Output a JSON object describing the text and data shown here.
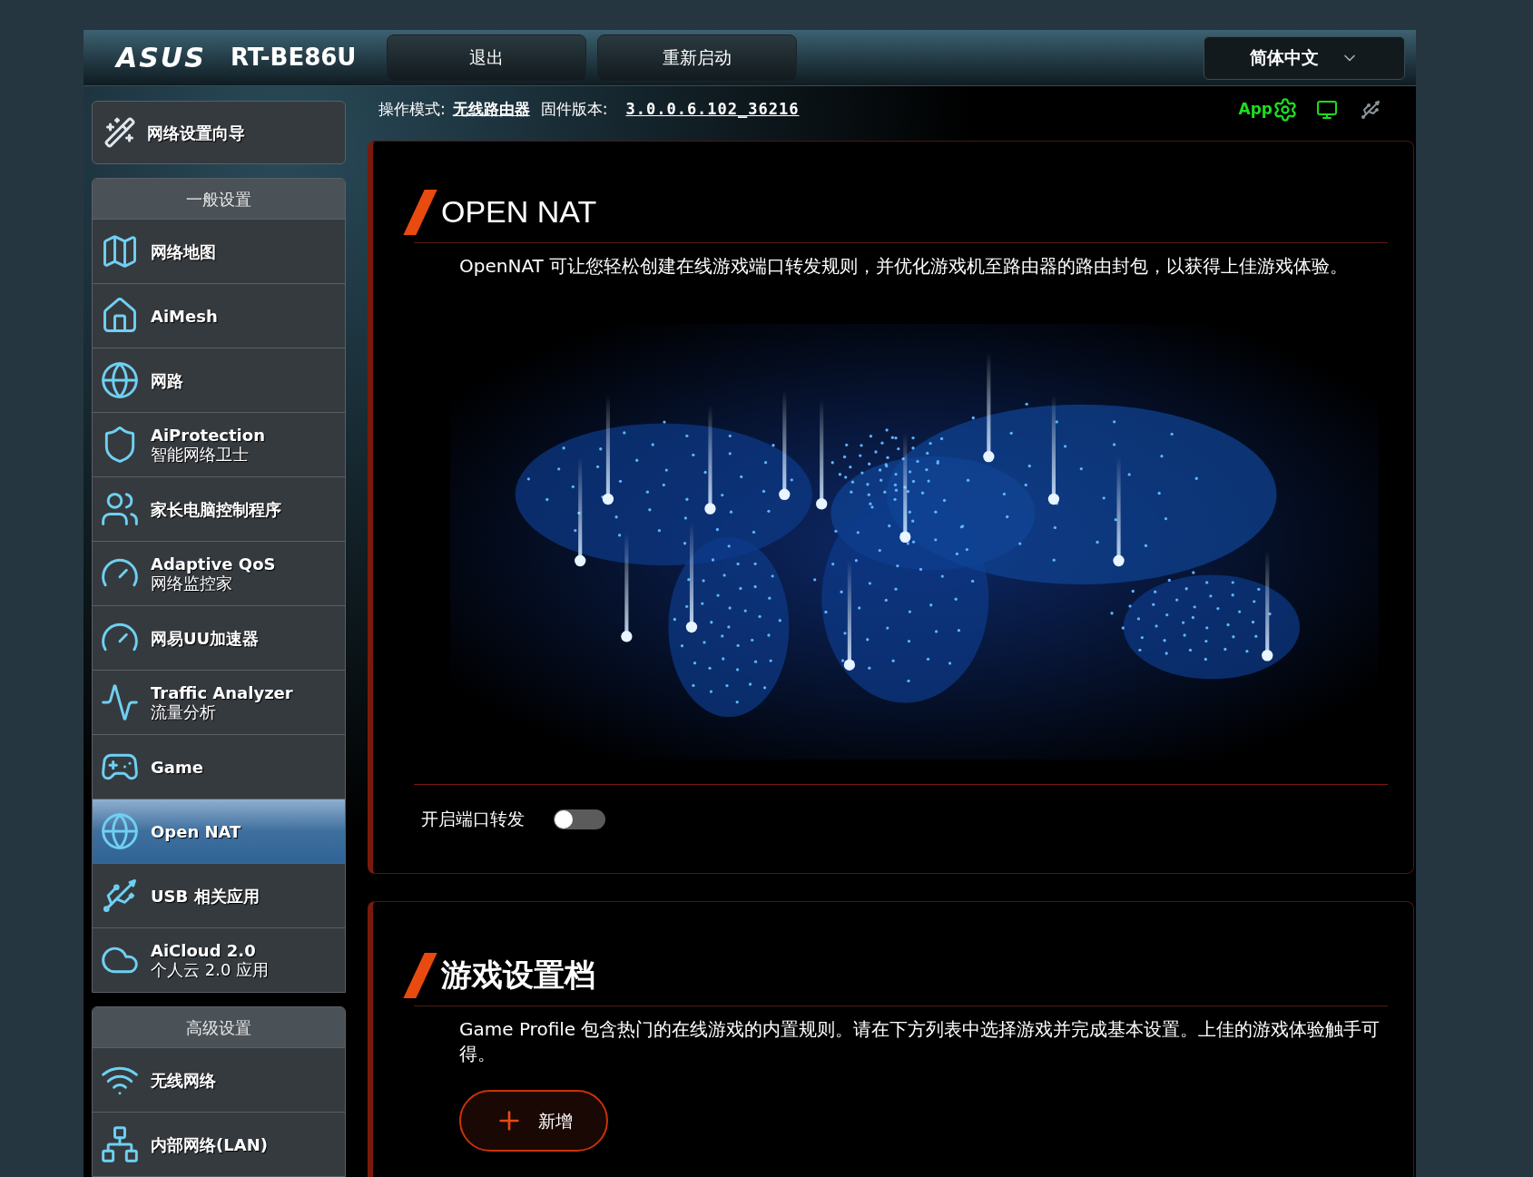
{
  "header": {
    "brand": "ASUS",
    "model": "RT-BE86U",
    "buttons": [
      "退出",
      "重新启动"
    ],
    "language": "简体中文"
  },
  "status": {
    "mode_label": "操作模式:",
    "mode": "无线路由器",
    "firmware_label": "固件版本:",
    "firmware": "3.0.0.6.102_36216",
    "app": "App"
  },
  "sidebar": {
    "wizard": "网络设置向导",
    "groups": [
      {
        "title": "一般设置",
        "items": [
          {
            "label": "网络地图",
            "selected": false
          },
          {
            "label": "AiMesh",
            "selected": false
          },
          {
            "label": "网路",
            "selected": false
          },
          {
            "label": "AiProtection",
            "sublabel": "智能网络卫士",
            "selected": false
          },
          {
            "label": "家长电脑控制程序",
            "selected": false
          },
          {
            "label": "Adaptive QoS",
            "sublabel": "网络监控家",
            "selected": false
          },
          {
            "label": "网易UU加速器",
            "selected": false
          },
          {
            "label": "Traffic Analyzer",
            "sublabel": "流量分析",
            "selected": false
          },
          {
            "label": "Game",
            "selected": false
          },
          {
            "label": "Open NAT",
            "selected": true
          },
          {
            "label": "USB 相关应用",
            "selected": false
          },
          {
            "label": "AiCloud 2.0",
            "sublabel": "个人云 2.0 应用",
            "selected": false
          }
        ]
      },
      {
        "title": "高级设置",
        "items": [
          {
            "label": "无线网络",
            "selected": false
          },
          {
            "label": "内部网络(LAN)",
            "selected": false
          }
        ]
      }
    ]
  },
  "panels": [
    {
      "title": "OPEN NAT",
      "description": "OpenNAT 可让您轻松创建在线游戏端口转发规则，并优化游戏机至路由器的路由封包，以获得上佳游戏体验。",
      "toggle": {
        "label": "开启端口转发",
        "on": false
      }
    },
    {
      "title": "游戏设置档",
      "description": "Game Profile 包含热门的在线游戏的内置规则。请在下方列表中选择游戏并完成基本设置。上佳的游戏体验触手可得。",
      "button": "新增"
    }
  ]
}
